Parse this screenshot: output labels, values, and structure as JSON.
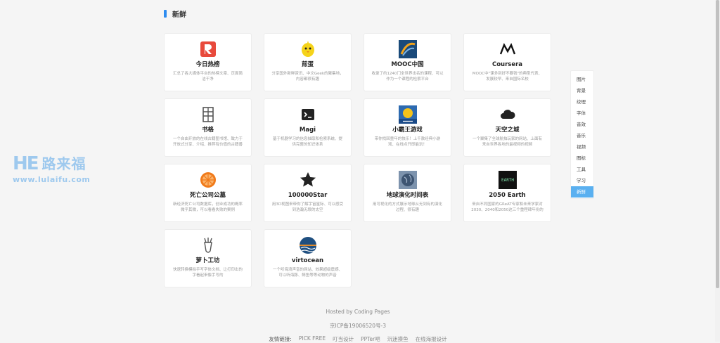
{
  "section": {
    "title": "新鲜"
  },
  "cards": [
    {
      "title": "今日热榜",
      "desc": "汇总了各大媒体平台的热榜文章、页面简洁干净",
      "icon": "r-logo-icon",
      "color": "#e84a3c"
    },
    {
      "title": "煎蛋",
      "desc": "分享国外新鲜资讯、中文Geek的聚集地，内容都很有趣",
      "icon": "yellow-chick-icon",
      "color": "#f5d31a"
    },
    {
      "title": "MOOC中国",
      "desc": "收录了约1240门全世界出名的课程、可以作为一个课程的检索平台",
      "icon": "mooc-logo-icon",
      "color": "#1a4a7a"
    },
    {
      "title": "Coursera",
      "desc": "MOOC中\"课多到好不要钱\"的典型代表、发展较早、来自国际名校",
      "icon": "coursera-logo-icon",
      "color": "#111111"
    },
    {
      "title": "书格",
      "desc": "一个自由开放的在线古籍图书馆、致力于开放式分享、介绍、推荐有价值的古籍善本",
      "icon": "shu-character-icon",
      "color": "#555555"
    },
    {
      "title": "Magi",
      "desc": "基于机器学习的信息抽取和检索系统、提供完整的知识体系",
      "icon": "terminal-icon",
      "color": "#222222"
    },
    {
      "title": "小霸王游戏",
      "desc": "带你找回童年的快乐！上千款经典小游戏、在线点开即能玩！",
      "icon": "yikm-logo-icon",
      "color": "#2d6ab0"
    },
    {
      "title": "天空之城",
      "desc": "一个聚集了全球航拍玩家的网站、上面有来自世界各地的最视频的视频",
      "icon": "cloud-icon",
      "color": "#222222"
    },
    {
      "title": "死亡公司公墓",
      "desc": "新经济死亡公司数据库，创业成功的概率微乎其微，可以看看失败的案例",
      "icon": "orange-slice-icon",
      "color": "#f07a1a"
    },
    {
      "title": "100000Star",
      "desc": "用3D视图来带你了解宇宙星际、可以感受到浩瀚无垠的太空",
      "icon": "star-icon",
      "color": "#222222"
    },
    {
      "title": "地球演化时间表",
      "desc": "用可视化的方式展示地球从无到有的演化过程、很有趣",
      "icon": "globe-icon",
      "color": "#7d93ad"
    },
    {
      "title": "2050 Earth",
      "desc": "来自不同国家的GReAT专家和未来学家对2030、2040和2050这三个重程碑年份的预测",
      "icon": "earth-2050-icon",
      "color": "#111111"
    },
    {
      "title": "萝卜工坊",
      "desc": "快速转换模拟手写字体文档、让打印出的字看起来像手写的",
      "icon": "radish-icon",
      "color": "#555555"
    },
    {
      "title": "virtocean",
      "desc": "一个听海浪声音的网站、效果超级震撼、可以听海豚、鲸鱼等等动物的声音",
      "icon": "ocean-wave-icon",
      "color": "#1f4f80"
    }
  ],
  "sidenav": {
    "items": [
      "图片",
      "背景",
      "纹理",
      "字体",
      "音效",
      "音乐",
      "视频",
      "图标",
      "工具",
      "学习",
      "新鲜"
    ],
    "active_index": 10,
    "active_color": "#5ab0f0"
  },
  "logo": {
    "mark": "HE",
    "name": "路来福",
    "url": "www.lulaifu.com"
  },
  "footer": {
    "hosted": "Hosted by Coding Pages",
    "icp": "京ICP备19006520号-3",
    "links_label": "友情链接:",
    "links": [
      "PICK FREE",
      "叮当设计",
      "PPTer吧",
      "沉迷摸鱼",
      "在线海报设计"
    ]
  }
}
